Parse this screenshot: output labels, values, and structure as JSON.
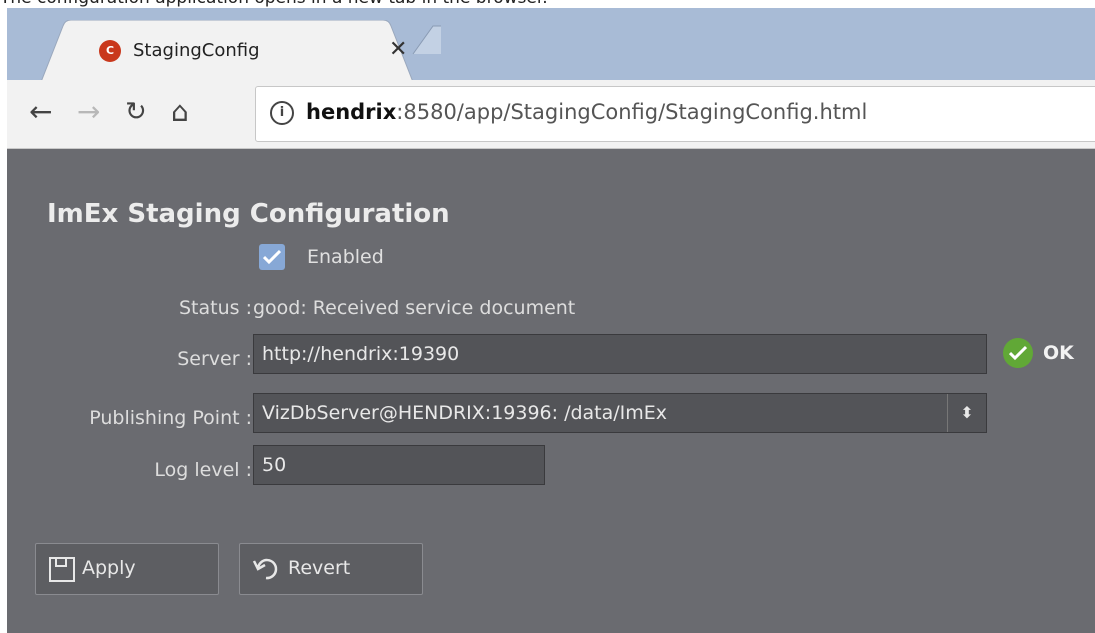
{
  "caption": "The configuration application opens in a new tab in the browser.",
  "browser": {
    "tab_title": "StagingConfig",
    "tab_icon_text": "C",
    "tab_close": "✕",
    "url_host": "hendrix",
    "url_rest": ":8580/app/StagingConfig/StagingConfig.html",
    "nav_back": "←",
    "nav_forward": "→",
    "nav_reload": "↻",
    "nav_home": "⌂",
    "info_icon": "i"
  },
  "page": {
    "title": "ImEx Staging Configuration",
    "enabled_label": "Enabled",
    "enabled_checked": true,
    "status_label": "Status :",
    "status_value": "good: Received service document",
    "server_label": "Server :",
    "server_value": "http://hendrix:19390",
    "server_ok": "OK",
    "publishing_label": "Publishing Point :",
    "publishing_value": "VizDbServer@HENDRIX:19396: /data/ImEx",
    "publishing_arrows": "⬍",
    "loglevel_label": "Log level :",
    "loglevel_value": "50",
    "apply_label": "Apply",
    "revert_label": "Revert"
  },
  "colors": {
    "content_bg": "#6a6b70",
    "titlebar_bg": "#a8bbd6",
    "ok_green": "#61a836",
    "checkbox_blue": "#87a8d6"
  }
}
